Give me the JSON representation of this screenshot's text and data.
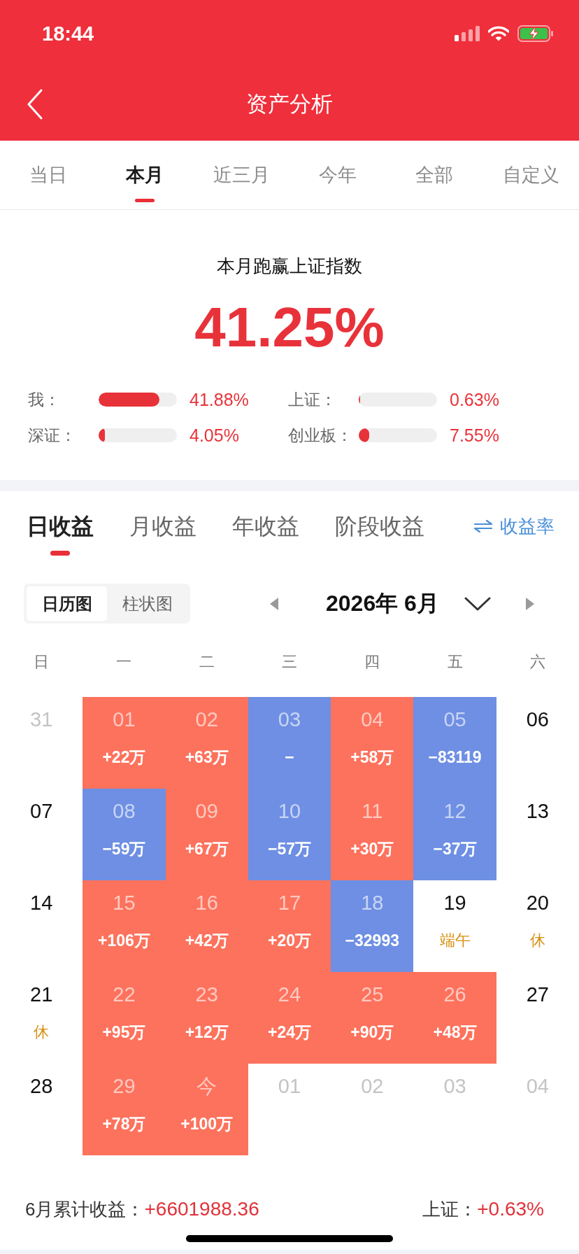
{
  "status_bar": {
    "time": "18:44"
  },
  "header": {
    "title": "资产分析"
  },
  "period_tabs": [
    {
      "label": "当日",
      "selected": false
    },
    {
      "label": "本月",
      "selected": true
    },
    {
      "label": "近三月",
      "selected": false
    },
    {
      "label": "今年",
      "selected": false
    },
    {
      "label": "全部",
      "selected": false
    },
    {
      "label": "自定义",
      "selected": false
    }
  ],
  "summary": {
    "title": "本月跑赢上证指数",
    "value": "41.25%",
    "comparisons": [
      {
        "label": "我：",
        "level": 0.78,
        "reading": "41.88%"
      },
      {
        "label": "上证：",
        "level": 0.015,
        "reading": "0.63%"
      },
      {
        "label": "深证：",
        "level": 0.08,
        "reading": "4.05%"
      },
      {
        "label": "创业板：",
        "level": 0.13,
        "reading": "7.55%"
      }
    ]
  },
  "returns_tabs": [
    {
      "label": "日收益",
      "selected": true
    },
    {
      "label": "月收益",
      "selected": false
    },
    {
      "label": "年收益",
      "selected": false
    },
    {
      "label": "阶段收益",
      "selected": false
    }
  ],
  "rate_switch": {
    "label": "收益率"
  },
  "view_toggle": [
    {
      "label": "日历图",
      "selected": true
    },
    {
      "label": "柱状图",
      "selected": false
    }
  ],
  "month_nav": {
    "title": "2026年 6月"
  },
  "calendar": {
    "weekdays": [
      "日",
      "一",
      "二",
      "三",
      "四",
      "五",
      "六"
    ],
    "weeks": [
      [
        {
          "day": "31",
          "kind": "other_month"
        },
        {
          "day": "01",
          "kind": "gain",
          "value": "+22万"
        },
        {
          "day": "02",
          "kind": "gain",
          "value": "+63万"
        },
        {
          "day": "03",
          "kind": "loss",
          "value": "−"
        },
        {
          "day": "04",
          "kind": "gain",
          "value": "+58万"
        },
        {
          "day": "05",
          "kind": "loss",
          "value": "−83119"
        },
        {
          "day": "06",
          "kind": "no_trade"
        }
      ],
      [
        {
          "day": "07",
          "kind": "no_trade"
        },
        {
          "day": "08",
          "kind": "loss",
          "value": "−59万"
        },
        {
          "day": "09",
          "kind": "gain",
          "value": "+67万"
        },
        {
          "day": "10",
          "kind": "loss",
          "value": "−57万"
        },
        {
          "day": "11",
          "kind": "gain",
          "value": "+30万"
        },
        {
          "day": "12",
          "kind": "loss",
          "value": "−37万"
        },
        {
          "day": "13",
          "kind": "no_trade"
        }
      ],
      [
        {
          "day": "14",
          "kind": "no_trade"
        },
        {
          "day": "15",
          "kind": "gain",
          "value": "+106万"
        },
        {
          "day": "16",
          "kind": "gain",
          "value": "+42万"
        },
        {
          "day": "17",
          "kind": "gain",
          "value": "+20万"
        },
        {
          "day": "18",
          "kind": "loss",
          "value": "−32993"
        },
        {
          "day": "19",
          "kind": "no_trade",
          "note": "端午"
        },
        {
          "day": "20",
          "kind": "no_trade",
          "note": "休"
        }
      ],
      [
        {
          "day": "21",
          "kind": "no_trade",
          "note": "休"
        },
        {
          "day": "22",
          "kind": "gain",
          "value": "+95万"
        },
        {
          "day": "23",
          "kind": "gain",
          "value": "+12万"
        },
        {
          "day": "24",
          "kind": "gain",
          "value": "+24万"
        },
        {
          "day": "25",
          "kind": "gain",
          "value": "+90万"
        },
        {
          "day": "26",
          "kind": "gain",
          "value": "+48万"
        },
        {
          "day": "27",
          "kind": "no_trade"
        }
      ],
      [
        {
          "day": "28",
          "kind": "no_trade"
        },
        {
          "day": "29",
          "kind": "gain",
          "value": "+78万"
        },
        {
          "day": "今",
          "kind": "gain",
          "value": "+100万"
        },
        {
          "day": "01",
          "kind": "other_month"
        },
        {
          "day": "02",
          "kind": "other_month"
        },
        {
          "day": "03",
          "kind": "other_month"
        },
        {
          "day": "04",
          "kind": "other_month"
        }
      ]
    ]
  },
  "footer": {
    "label": "6月累计收益：",
    "value": "+6601988.36",
    "index_label": "上证：",
    "index_value": "+0.63%"
  }
}
